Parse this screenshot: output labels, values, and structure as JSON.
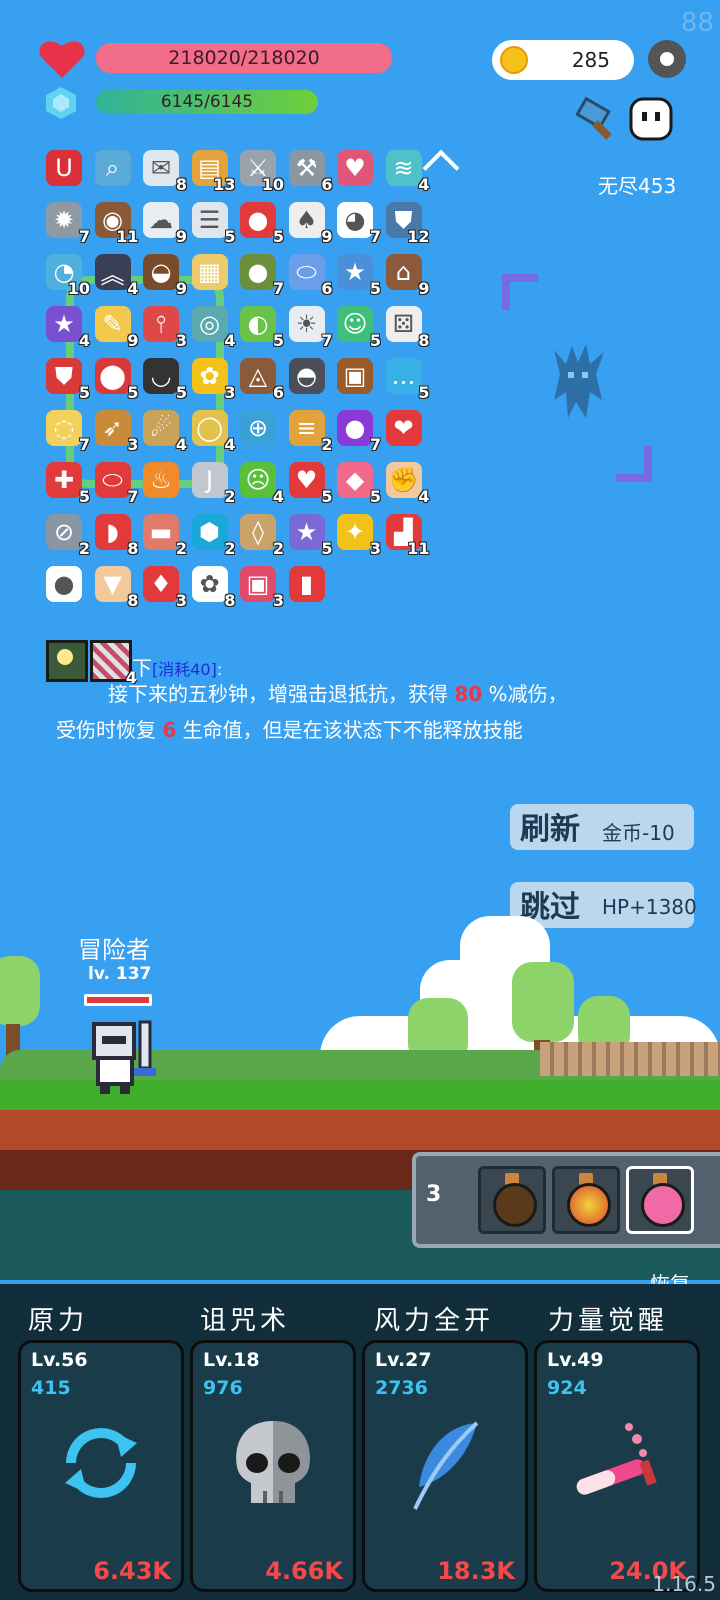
{
  "hud": {
    "hp_text": "218020/218020",
    "hp_fraction": 1.0,
    "mana_text": "6145/6145",
    "mana_fraction": 1.0,
    "coins": "285",
    "endless_label": "无尽453",
    "fps": "88",
    "version": "1.16.5"
  },
  "items": [
    {
      "icon": "magnet-icon",
      "count": "",
      "color": "#d9303a",
      "glyph": "U"
    },
    {
      "icon": "magnifier-icon",
      "count": "",
      "color": "#5aa9d6",
      "glyph": "⌕"
    },
    {
      "icon": "envelope-icon",
      "count": "8",
      "color": "#dfe6ee",
      "glyph": "✉"
    },
    {
      "icon": "book-icon",
      "count": "13",
      "color": "#e3a33a",
      "glyph": "▤"
    },
    {
      "icon": "sword-icon",
      "count": "10",
      "color": "#9aa3ad",
      "glyph": "⚔"
    },
    {
      "icon": "axe-icon",
      "count": "6",
      "color": "#8a97a3",
      "glyph": "⚒"
    },
    {
      "icon": "heart-card-icon",
      "count": "",
      "color": "#e0557a",
      "glyph": "♥"
    },
    {
      "icon": "scroll-icon",
      "count": "4",
      "color": "#4fc1c9",
      "glyph": "≋"
    },
    {
      "icon": "spiked-ball-icon",
      "count": "7",
      "color": "#8e99a3",
      "glyph": "✹"
    },
    {
      "icon": "shield-round-icon",
      "count": "11",
      "color": "#8a5a36",
      "glyph": "◉"
    },
    {
      "icon": "cloud-icon",
      "count": "9",
      "color": "#e7edf2",
      "glyph": "☁"
    },
    {
      "icon": "clipboard-icon",
      "count": "5",
      "color": "#dfe6ee",
      "glyph": "☰"
    },
    {
      "icon": "apple-icon",
      "count": "5",
      "color": "#e23a3a",
      "glyph": "●"
    },
    {
      "icon": "cards-icon",
      "count": "9",
      "color": "#eeeeee",
      "glyph": "♠"
    },
    {
      "icon": "ghost-icon",
      "count": "7",
      "color": "#ffffff",
      "glyph": "◕"
    },
    {
      "icon": "shield-icon",
      "count": "12",
      "color": "#4a78a8",
      "glyph": "⛊"
    },
    {
      "icon": "bomb-timer-icon",
      "count": "10",
      "color": "#4fb0df",
      "glyph": "◔"
    },
    {
      "icon": "bat-icon",
      "count": "4",
      "color": "#3b3f55",
      "glyph": "︽"
    },
    {
      "icon": "coconut-icon",
      "count": "9",
      "color": "#7a4b2b",
      "glyph": "◒"
    },
    {
      "icon": "map-icon",
      "count": "",
      "color": "#eccb6a",
      "glyph": "▦"
    },
    {
      "icon": "grenade-icon",
      "count": "7",
      "color": "#6b8f3a",
      "glyph": "●"
    },
    {
      "icon": "pill-icon",
      "count": "6",
      "color": "#6b9ee8",
      "glyph": "⬭"
    },
    {
      "icon": "star-card-icon",
      "count": "5",
      "color": "#4a90d8",
      "glyph": "★"
    },
    {
      "icon": "door-icon",
      "count": "9",
      "color": "#8a5a3a",
      "glyph": "⌂"
    },
    {
      "icon": "purple-hat-icon",
      "count": "4",
      "color": "#7a4fd0",
      "glyph": "★"
    },
    {
      "icon": "note-icon",
      "count": "9",
      "color": "#f2c94c",
      "glyph": "✎"
    },
    {
      "icon": "thermometer-icon",
      "count": "3",
      "color": "#e04848",
      "glyph": "⫯"
    },
    {
      "icon": "disc-icon",
      "count": "4",
      "color": "#5aaab0",
      "glyph": "◎"
    },
    {
      "icon": "lime-icon",
      "count": "5",
      "color": "#6bc24a",
      "glyph": "◐"
    },
    {
      "icon": "lightbulb-icon",
      "count": "7",
      "color": "#e7edf2",
      "glyph": "☀"
    },
    {
      "icon": "green-sprite-icon",
      "count": "5",
      "color": "#3fc07a",
      "glyph": "☺"
    },
    {
      "icon": "dice-icon",
      "count": "8",
      "color": "#eeeeee",
      "glyph": "⚄"
    },
    {
      "icon": "red-shield-icon",
      "count": "5",
      "color": "#d83a3a",
      "glyph": "⛊"
    },
    {
      "icon": "mushroom-icon",
      "count": "5",
      "color": "#d83a3a",
      "glyph": "⬤"
    },
    {
      "icon": "cauldron-icon",
      "count": "5",
      "color": "#333333",
      "glyph": "◡"
    },
    {
      "icon": "sunflower-icon",
      "count": "3",
      "color": "#f2c21a",
      "glyph": "✿"
    },
    {
      "icon": "cake-icon",
      "count": "6",
      "color": "#8a5a3a",
      "glyph": "◬"
    },
    {
      "icon": "hood-icon",
      "count": "",
      "color": "#4a4f5a",
      "glyph": "◓"
    },
    {
      "icon": "treasure-chest-icon",
      "count": "",
      "color": "#9a5a2a",
      "glyph": "▣"
    },
    {
      "icon": "chat-bubble-icon",
      "count": "5",
      "color": "#3ab0e8",
      "glyph": "…"
    },
    {
      "icon": "halo-icon",
      "count": "7",
      "color": "#f2d25a",
      "glyph": "◌"
    },
    {
      "icon": "bow-icon",
      "count": "3",
      "color": "#c98a3a",
      "glyph": "➶"
    },
    {
      "icon": "meteor-icon",
      "count": "4",
      "color": "#c9a35a",
      "glyph": "☄"
    },
    {
      "icon": "ring-icon",
      "count": "4",
      "color": "#e2c24a",
      "glyph": "◯"
    },
    {
      "icon": "target-icon",
      "count": "",
      "color": "#3aa0d8",
      "glyph": "⊕"
    },
    {
      "icon": "parchment-icon",
      "count": "2",
      "color": "#e2a43a",
      "glyph": "≡"
    },
    {
      "icon": "crystal-ball-icon",
      "count": "7",
      "color": "#8a3ad8",
      "glyph": "●"
    },
    {
      "icon": "hearts-icon",
      "count": "",
      "color": "#e23a3a",
      "glyph": "❤"
    },
    {
      "icon": "gift-icon",
      "count": "5",
      "color": "#e23a3a",
      "glyph": "✚"
    },
    {
      "icon": "capsule-icon",
      "count": "7",
      "color": "#e23a3a",
      "glyph": "⬭"
    },
    {
      "icon": "torch-icon",
      "count": "",
      "color": "#f08a2a",
      "glyph": "♨"
    },
    {
      "icon": "hook-icon",
      "count": "2",
      "color": "#c0c7ce",
      "glyph": "J"
    },
    {
      "icon": "zombie-icon",
      "count": "4",
      "color": "#5ac03a",
      "glyph": "☹"
    },
    {
      "icon": "heart-icon",
      "count": "5",
      "color": "#e23a3a",
      "glyph": "♥"
    },
    {
      "icon": "bottle-icon",
      "count": "5",
      "color": "#f26a8a",
      "glyph": "◆"
    },
    {
      "icon": "fist-icon",
      "count": "4",
      "color": "#f2c99a",
      "glyph": "✊"
    },
    {
      "icon": "compass-icon",
      "count": "2",
      "color": "#8a97a3",
      "glyph": "⊘"
    },
    {
      "icon": "watermelon-icon",
      "count": "8",
      "color": "#e23a3a",
      "glyph": "◗"
    },
    {
      "icon": "steak-icon",
      "count": "2",
      "color": "#e07a6a",
      "glyph": "▬"
    },
    {
      "icon": "gem-icon",
      "count": "2",
      "color": "#1aa8d8",
      "glyph": "⬢"
    },
    {
      "icon": "noose-icon",
      "count": "2",
      "color": "#c9a36a",
      "glyph": "◊"
    },
    {
      "icon": "star-shield-icon",
      "count": "5",
      "color": "#7a6ad8",
      "glyph": "★"
    },
    {
      "icon": "magic-wand-icon",
      "count": "3",
      "color": "#f2c21a",
      "glyph": "✦"
    },
    {
      "icon": "sock-icon",
      "count": "11",
      "color": "#e23a3a",
      "glyph": "▟"
    },
    {
      "icon": "fried-egg-icon",
      "count": "",
      "color": "#ffffff",
      "glyph": "●"
    },
    {
      "icon": "ice-cream-icon",
      "count": "8",
      "color": "#f2c99a",
      "glyph": "▼"
    },
    {
      "icon": "strawberry-icon",
      "count": "3",
      "color": "#e23a3a",
      "glyph": "♦"
    },
    {
      "icon": "flower-icon",
      "count": "8",
      "color": "#ffffff",
      "glyph": "✿"
    },
    {
      "icon": "jam-jar-icon",
      "count": "3",
      "color": "#e24a6a",
      "glyph": "▣"
    },
    {
      "icon": "bookmark-icon",
      "count": "",
      "color": "#e23a3a",
      "glyph": "▮"
    }
  ],
  "selected": {
    "icons": [
      {
        "icon": "lightbulb-frame-icon",
        "count": ""
      },
      {
        "icon": "pattern-frame-icon",
        "count": "4"
      }
    ],
    "name_fragment": "下",
    "cost": "[消耗40]",
    "colon": ":",
    "line1_a": "接下来的五秒钟，增强击退抵抗，获得 ",
    "line1_num": "80",
    "line1_b": " %减伤，",
    "line2_a": "受伤时恢复 ",
    "line2_num": "6",
    "line2_b": " 生命值，但是在该状态下不能释放技能"
  },
  "buttons": {
    "refresh_label": "刷新",
    "refresh_cost": "金币-10",
    "skip_label": "跳过",
    "skip_reward": "HP+1380"
  },
  "player": {
    "name": "冒险者",
    "level": "lv. 137",
    "hp_fraction": 1.0
  },
  "potions": {
    "count": "3",
    "label": "恢复",
    "colors": [
      "#5a3a1a",
      "#d84a2a",
      "#f06aa8"
    ]
  },
  "skills": [
    {
      "name": "原力",
      "level": "Lv.56",
      "value": "415",
      "cost": "6.43K",
      "art": "refresh-icon"
    },
    {
      "name": "诅咒术",
      "level": "Lv.18",
      "value": "976",
      "cost": "4.66K",
      "art": "skull-icon"
    },
    {
      "name": "风力全开",
      "level": "Lv.27",
      "value": "2736",
      "cost": "18.3K",
      "art": "feather-icon"
    },
    {
      "name": "力量觉醒",
      "level": "Lv.49",
      "value": "924",
      "cost": "24.0K",
      "art": "potion-vial-icon"
    }
  ],
  "colors": {
    "sky": "#37a0f0",
    "hp_bar": "#f26d8a",
    "mana_bar": "#3fc56a",
    "skill_value": "#3cc3ef",
    "skill_cost": "#f24a4a"
  }
}
